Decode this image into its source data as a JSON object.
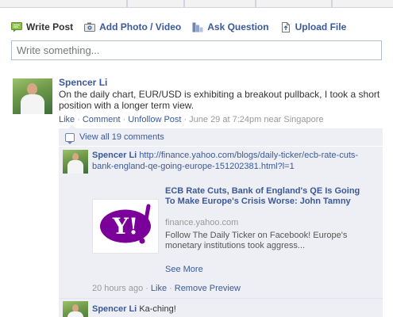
{
  "composer": {
    "actions": [
      {
        "label": "Write Post",
        "icon": "write-post-icon"
      },
      {
        "label": "Add Photo / Video",
        "icon": "camera-icon"
      },
      {
        "label": "Ask Question",
        "icon": "question-icon"
      },
      {
        "label": "Upload File",
        "icon": "file-icon"
      }
    ],
    "placeholder": "Write something..."
  },
  "post": {
    "author": "Spencer Li",
    "text": "On the daily chart, EUR/USD is exhibiting a breakout pullback, I took a short position with a longer term view.",
    "actions": {
      "like": "Like",
      "comment": "Comment",
      "unfollow": "Unfollow Post",
      "timestamp": "June 29 at 7:24pm near Singapore"
    }
  },
  "comments": {
    "view_all": "View all 19 comments",
    "items": [
      {
        "author": "Spencer Li",
        "link": "http://finance.yahoo.com/blogs/daily-ticker/ecb-rate-cuts-bank-england-qe-going-europe-151202381.html?l=1",
        "preview": {
          "title": "ECB Rate Cuts, Bank of England's QE Is Going To Make Europe's Crisis Worse: John Tamny",
          "domain": "finance.yahoo.com",
          "description": "Follow The Daily Ticker on Facebook! Europe's monetary institutions took aggress...",
          "see_more": "See More",
          "logo_text": "Y!"
        },
        "time": "20 hours ago",
        "like": "Like",
        "remove": "Remove Preview"
      },
      {
        "author": "Spencer Li",
        "text": "Ka-ching!"
      }
    ]
  },
  "colors": {
    "link": "#3b5998",
    "ufi_bg": "#edeff4",
    "yahoo_purple": "#7b0099"
  }
}
